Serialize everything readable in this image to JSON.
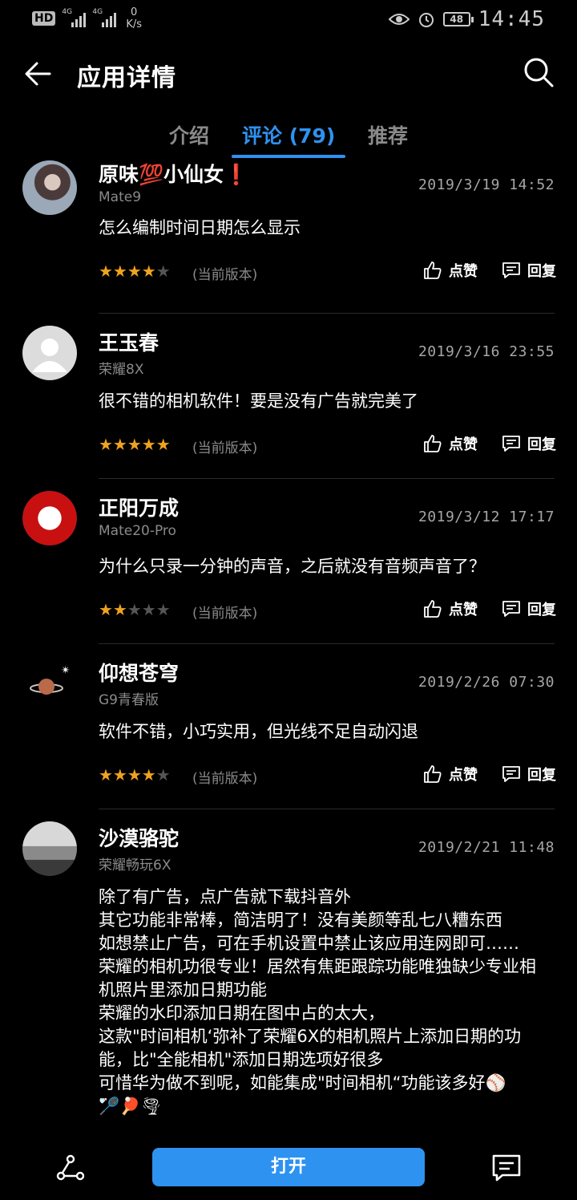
{
  "status_bar": {
    "hd_label": "HD",
    "net1": "4G",
    "net2": "4G",
    "speed_value": "0",
    "speed_unit": "K/s",
    "battery": "48",
    "time": "14:45"
  },
  "header": {
    "title": "应用详情"
  },
  "tabs": [
    {
      "label": "介绍",
      "active": false
    },
    {
      "label": "评论 (79)",
      "active": true
    },
    {
      "label": "推荐",
      "active": false
    }
  ],
  "actions": {
    "like_label": "点赞",
    "reply_label": "回复",
    "version_label": "(当前版本)"
  },
  "reviews": [
    {
      "name": "原味💯小仙女❗",
      "device": "Mate9",
      "date": "2019/3/19 14:52",
      "text": "怎么编制时间日期怎么显示",
      "stars": 4
    },
    {
      "name": "王玉春",
      "device": "荣耀8X",
      "date": "2019/3/16 23:55",
      "text": "很不错的相机软件！要是没有广告就完美了",
      "stars": 5
    },
    {
      "name": "正阳万成",
      "device": "Mate20-Pro",
      "date": "2019/3/12 17:17",
      "text": "为什么只录一分钟的声音，之后就没有音频声音了？",
      "stars": 2
    },
    {
      "name": "仰想苍穹",
      "device": "G9青春版",
      "date": "2019/2/26 07:30",
      "text": "软件不错，小巧实用，但光线不足自动闪退",
      "stars": 4
    },
    {
      "name": "沙漠骆驼",
      "device": "荣耀畅玩6X",
      "date": "2019/2/21 11:48",
      "text": "除了有广告，点广告就下载抖音外\n其它功能非常棒，简洁明了！没有美颜等乱七八糟东西\n如想禁止广告，可在手机设置中禁止该应用连网即可……\n荣耀的相机功很专业！居然有焦距跟踪功能唯独缺少专业相机照片里添加日期功能\n荣耀的水印添加日期在图中占的太大，\n这款\"时间相机‘弥补了荣耀6X的相机照片上添加日期的功能，比\"全能相机\"添加日期选项好很多\n可惜华为做不到呢，如能集成\"时间相机“功能该多好⚾\n🏸🏓🌪",
      "stars": 0
    }
  ],
  "bottom": {
    "open_label": "打开"
  },
  "colors": {
    "accent": "#2e92f0",
    "star": "#f0a31e",
    "background": "#000000"
  },
  "icons": [
    "back-arrow-icon",
    "search-icon",
    "thumbs-up-icon",
    "comment-icon",
    "share-icon"
  ]
}
